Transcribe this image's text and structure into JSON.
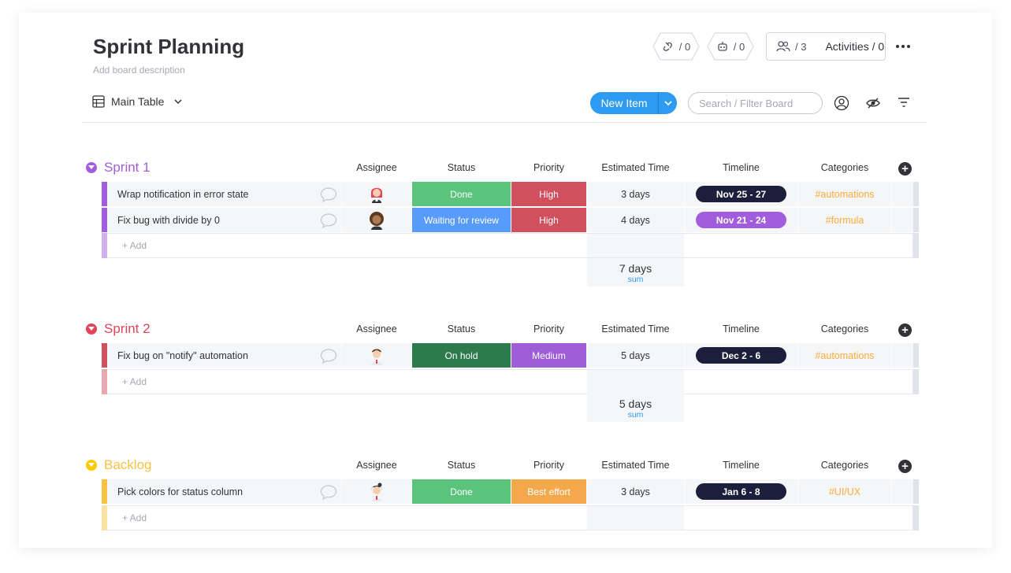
{
  "board": {
    "title": "Sprint Planning",
    "description": "Add board description",
    "integrations_count": "/ 0",
    "automations_count": "/ 0",
    "members_count": "/ 3",
    "activities_label": "Activities / 0"
  },
  "toolbar": {
    "view_label": "Main Table",
    "new_item_label": "New Item",
    "search_placeholder": "Search / Filter Board"
  },
  "columns": {
    "assignee": "Assignee",
    "status": "Status",
    "priority": "Priority",
    "estimated_time": "Estimated Time",
    "timeline": "Timeline",
    "categories": "Categories"
  },
  "colors": {
    "accent": "#2f9bf0",
    "sprint1": "#a25ddc",
    "sprint2": "#e2445c",
    "backlog": "#ffcb00",
    "done": "#00c875",
    "waiting": "#579bfc",
    "high": "#e2445c",
    "on_hold": "#037f4c",
    "medium": "#a25ddc",
    "best_effort": "#fdab3d",
    "timeline_dark": "#1c1f3b",
    "timeline_purple": "#a25ddc",
    "category_text": "#fdab3d"
  },
  "groups": [
    {
      "title": "Sprint 1",
      "add_label": "+ Add",
      "sum_value": "7 days",
      "sum_label": "sum",
      "rows": [
        {
          "name": "Wrap notification in error state",
          "avatar": "avatar-redhair-icon",
          "status": "Done",
          "priority": "High",
          "estimate": "3 days",
          "timeline": "Nov 25 - 27",
          "category": "#automations"
        },
        {
          "name": "Fix bug with divide by 0",
          "avatar": "avatar-curly-icon",
          "status": "Waiting for review",
          "priority": "High",
          "estimate": "4 days",
          "timeline": "Nov 21 - 24",
          "category": "#formula"
        }
      ]
    },
    {
      "title": "Sprint 2",
      "add_label": "+ Add",
      "sum_value": "5 days",
      "sum_label": "sum",
      "rows": [
        {
          "name": "Fix bug on \"notify\" automation",
          "avatar": "avatar-man-icon",
          "status": "On hold",
          "priority": "Medium",
          "estimate": "5 days",
          "timeline": "Dec 2 - 6",
          "category": "#automations"
        }
      ]
    },
    {
      "title": "Backlog",
      "add_label": "+ Add",
      "rows": [
        {
          "name": "Pick colors for status column",
          "avatar": "avatar-woman-icon",
          "status": "Done",
          "priority": "Best effort",
          "estimate": "3 days",
          "timeline": "Jan 6 - 8",
          "category": "#UI/UX"
        }
      ]
    }
  ]
}
